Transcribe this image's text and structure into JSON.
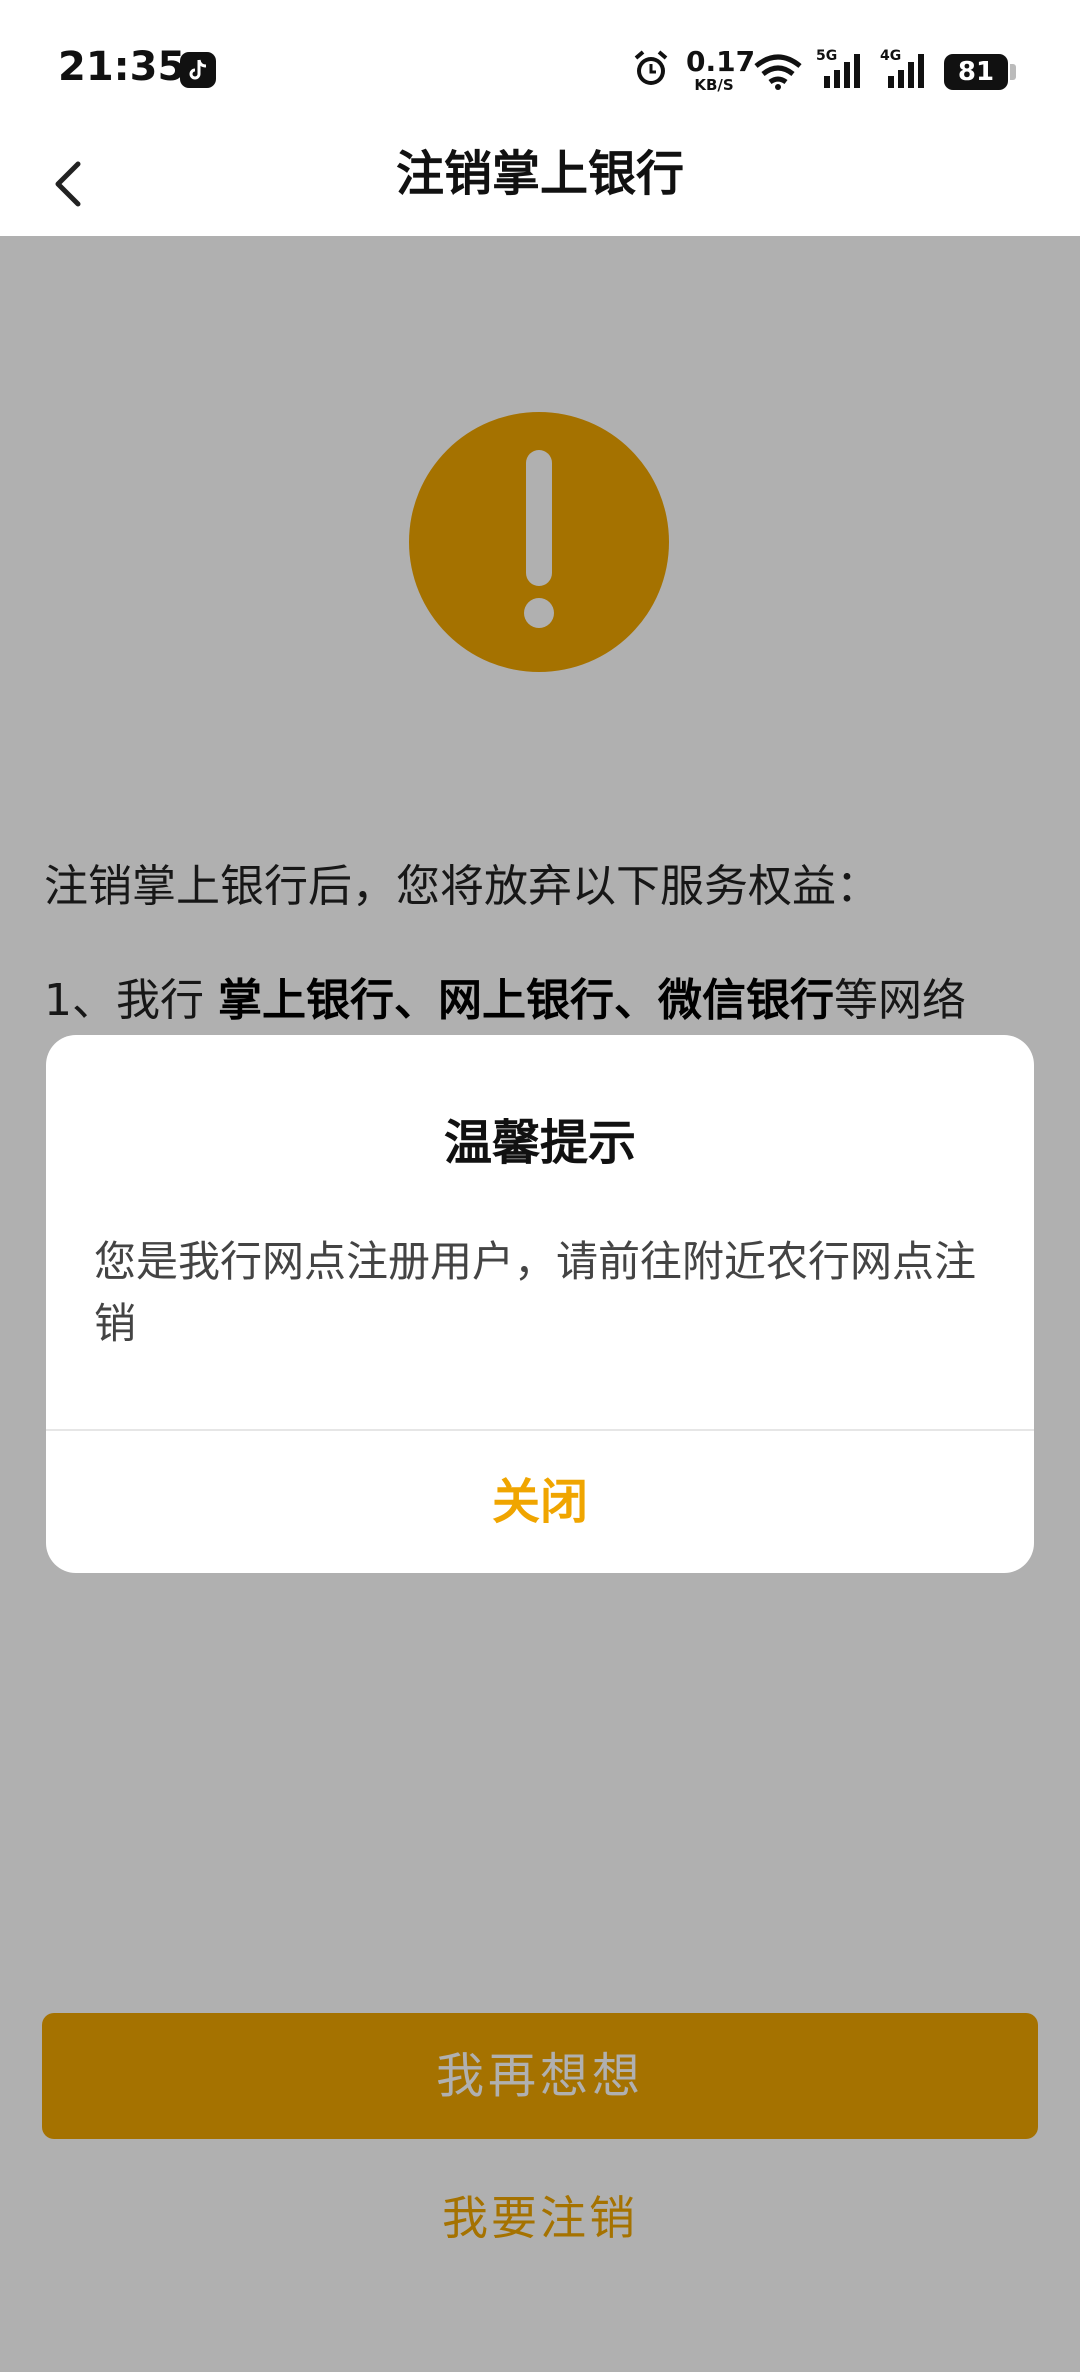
{
  "status_bar": {
    "time": "21:35",
    "net_speed_value": "0.17",
    "net_speed_unit": "KB/S",
    "signal1_label": "5G",
    "signal2_label": "4G",
    "battery": "81",
    "icons": [
      "tiktok-icon",
      "alarm-icon",
      "wifi-icon",
      "signal-5g-icon",
      "signal-4g-icon",
      "battery-icon"
    ]
  },
  "header": {
    "title": "注销掌上银行",
    "back_icon": "chevron-left-icon"
  },
  "content": {
    "intro": "注销掌上银行后，您将放弃以下服务权益：",
    "benefit_prefix": "1、我行 ",
    "benefit_bold": "掌上银行、网上银行、微信银行",
    "benefit_suffix": "等网络",
    "primary_button": "我再想想",
    "secondary_link": "我要注销"
  },
  "dialog": {
    "title": "温馨提示",
    "message": "您是我行网点注册用户，请前往附近农行网点注销",
    "close_button": "关闭"
  },
  "colors": {
    "accent": "#f0a500",
    "text": "#222222",
    "overlay": "rgba(0,0,0,0.31)"
  }
}
